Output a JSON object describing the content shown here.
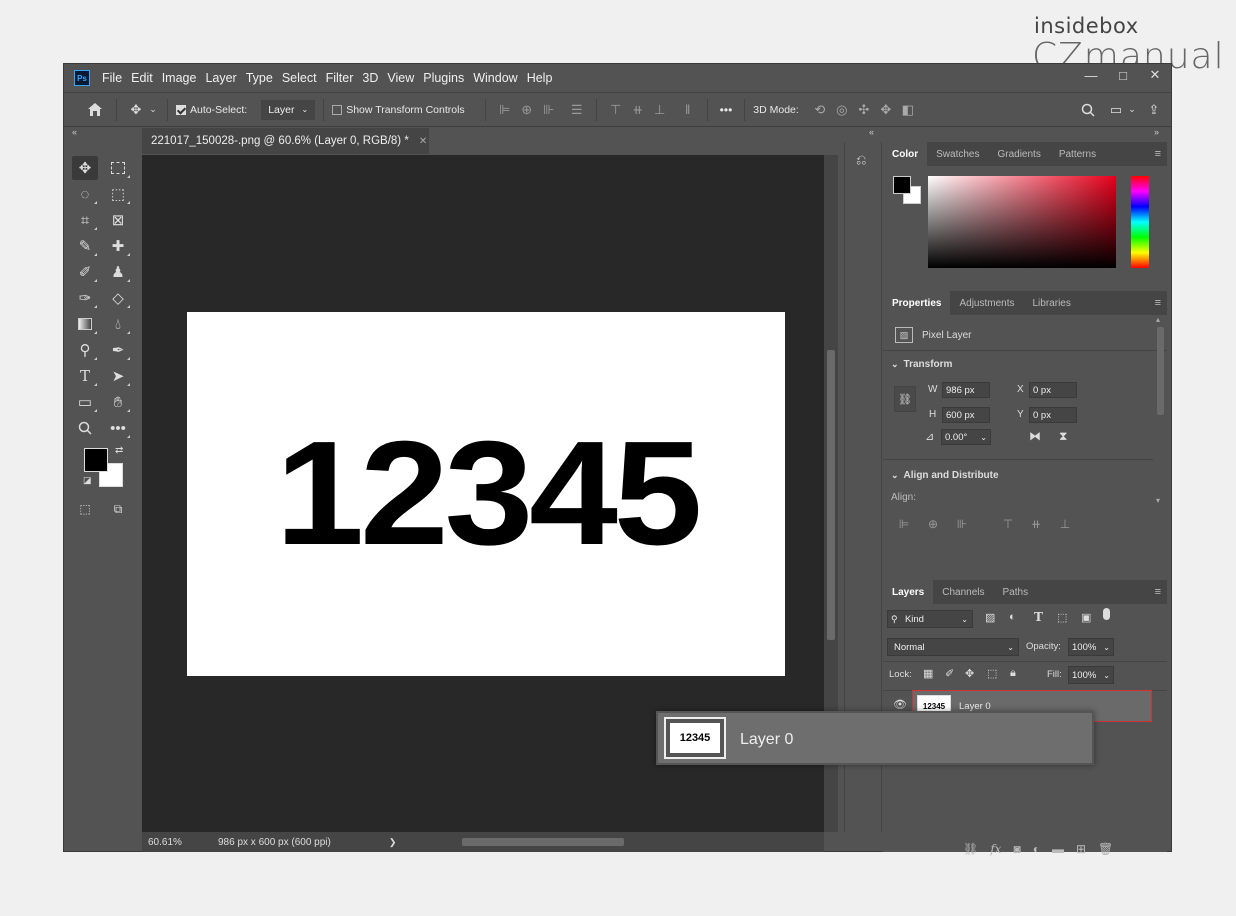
{
  "watermark": {
    "line1": "insidebox",
    "line2": "CZmanual"
  },
  "app": {
    "logo": "Ps"
  },
  "menu": [
    "File",
    "Edit",
    "Image",
    "Layer",
    "Type",
    "Select",
    "Filter",
    "3D",
    "View",
    "Plugins",
    "Window",
    "Help"
  ],
  "window_controls": {
    "minimize": "—",
    "maximize": "□",
    "close": "✕"
  },
  "options": {
    "auto_select_label": "Auto-Select:",
    "auto_select_value": "Layer",
    "show_transform_label": "Show Transform Controls",
    "more": "•••",
    "mode_3d_label": "3D Mode:"
  },
  "collapse": {
    "left": "«",
    "mid": "«",
    "right": "»"
  },
  "doc": {
    "tab_title": "221017_150028-.png @ 60.6% (Layer 0, RGB/8) *",
    "close": "✕"
  },
  "canvas": {
    "text": "12345"
  },
  "status": {
    "zoom": "60.61%",
    "info": "986 px x 600 px (600 ppi)",
    "arrow": "❯"
  },
  "color_panel": {
    "tabs": [
      "Color",
      "Swatches",
      "Gradients",
      "Patterns"
    ],
    "fg": "#000000",
    "bg": "#ffffff"
  },
  "properties": {
    "tabs": [
      "Properties",
      "Adjustments",
      "Libraries"
    ],
    "type": "Pixel Layer",
    "transform_label": "Transform",
    "w_label": "W",
    "w": "986 px",
    "h_label": "H",
    "h": "600 px",
    "x_label": "X",
    "x": "0 px",
    "y_label": "Y",
    "y": "0 px",
    "angle": "0.00°",
    "align_label": "Align and Distribute",
    "align_sub": "Align:"
  },
  "layers": {
    "tabs": [
      "Layers",
      "Channels",
      "Paths"
    ],
    "filter": "Kind",
    "blend": "Normal",
    "opacity_label": "Opacity:",
    "opacity": "100%",
    "lock_label": "Lock:",
    "fill_label": "Fill:",
    "fill": "100%",
    "layer_name": "Layer 0",
    "thumb_text": "12345"
  },
  "drag": {
    "name": "Layer 0",
    "thumb_text": "12345"
  }
}
